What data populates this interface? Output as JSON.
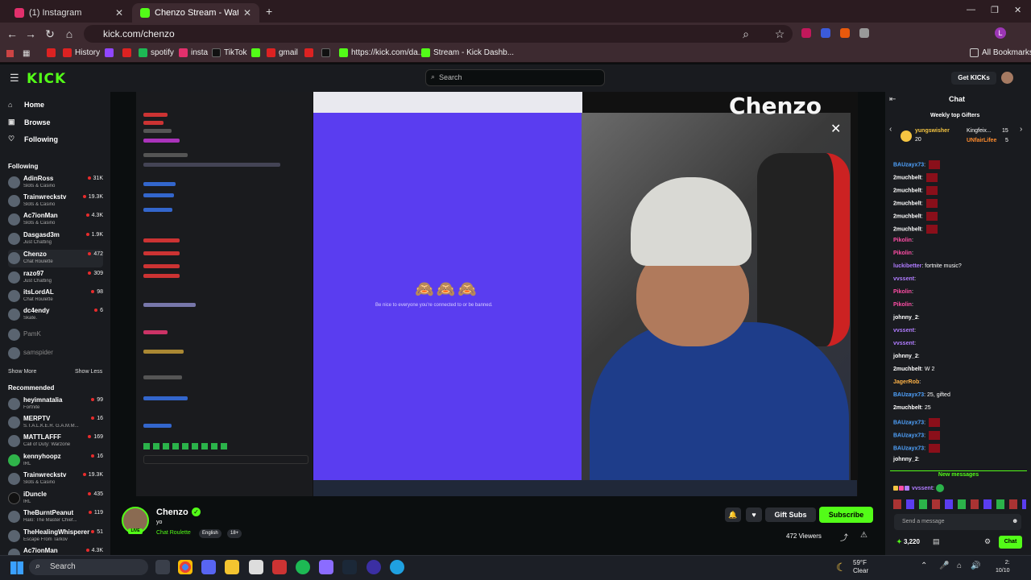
{
  "browser": {
    "tabs": [
      {
        "title": "(1) Instagram",
        "color": "#e1306c"
      },
      {
        "title": "Chenzo Stream - Watch Live on",
        "color": "#53fc18"
      }
    ],
    "url": "kick.com/chenzo",
    "bookmarks": [
      {
        "label": "History",
        "color": "#d22"
      },
      {
        "label": "spotify",
        "color": "#1db954"
      },
      {
        "label": "insta",
        "color": "#e1306c"
      },
      {
        "label": "TikTok",
        "color": "#222"
      },
      {
        "label": "gmail",
        "color": "#d22"
      },
      {
        "label": "https://kick.com/da...",
        "color": "#53fc18"
      },
      {
        "label": "Stream - Kick Dashb...",
        "color": "#53fc18"
      }
    ],
    "all_bookmarks": "All Bookmarks"
  },
  "kick": {
    "logo": "KICK",
    "search_placeholder": "Search",
    "get_kicks": "Get KICKs"
  },
  "sidebar": {
    "nav": [
      {
        "label": "Home",
        "icon": "home-icon"
      },
      {
        "label": "Browse",
        "icon": "browse-icon"
      },
      {
        "label": "Following",
        "icon": "heart-icon"
      }
    ],
    "following_header": "Following",
    "following": [
      {
        "name": "AdinRoss",
        "category": "Slots & Casino",
        "viewers": "31K"
      },
      {
        "name": "Trainwreckstv",
        "category": "Slots & Casino",
        "viewers": "19.3K"
      },
      {
        "name": "Ac7ionMan",
        "category": "Slots & Casino",
        "viewers": "4.3K"
      },
      {
        "name": "Dasgasd3m",
        "category": "Just Chatting",
        "viewers": "1.9K"
      },
      {
        "name": "Chenzo",
        "category": "Chat Roulette",
        "viewers": "472"
      },
      {
        "name": "razo97",
        "category": "Just Chatting",
        "viewers": "309"
      },
      {
        "name": "itsLordAL",
        "category": "Chat Roulette",
        "viewers": "98"
      },
      {
        "name": "dc4endy",
        "category": "Skate.",
        "viewers": "6"
      },
      {
        "name": "PamK",
        "category": "",
        "viewers": ""
      },
      {
        "name": "samspider",
        "category": "",
        "viewers": ""
      }
    ],
    "show_more": "Show More",
    "show_less": "Show Less",
    "recommended_header": "Recommended",
    "recommended": [
      {
        "name": "heyimnatalia",
        "category": "Fortnite",
        "viewers": "99"
      },
      {
        "name": "MERPTV",
        "category": "S.T.A.L.K.E.R. G.A.M.M...",
        "viewers": "16"
      },
      {
        "name": "MATTLAFFF",
        "category": "Call of Duty: Warzone",
        "viewers": "169"
      },
      {
        "name": "kennyhoopz",
        "category": "IRL",
        "viewers": "16"
      },
      {
        "name": "Trainwreckstv",
        "category": "Slots & Casino",
        "viewers": "19.3K"
      },
      {
        "name": "iDuncle",
        "category": "IRL",
        "viewers": "435"
      },
      {
        "name": "TheBurntPeanut",
        "category": "Halo: The Master Chief...",
        "viewers": "119"
      },
      {
        "name": "TheHealingWhisperer",
        "category": "Escape From Tarkov",
        "viewers": "51"
      },
      {
        "name": "Ac7ionMan",
        "category": "",
        "viewers": "4.3K"
      }
    ]
  },
  "stream": {
    "overlay_name": "Chenzo",
    "emojis": "🙈🙈🙈",
    "warning": "Be nice to everyone you're connected to or be banned.",
    "channel": "Chenzo",
    "live": "LIVE",
    "title": "yo",
    "category": "Chat Roulette",
    "tags": [
      "English",
      "18+"
    ],
    "gift_subs": "Gift Subs",
    "subscribe": "Subscribe",
    "viewers": "472 Viewers"
  },
  "chat": {
    "title": "Chat",
    "weekly_header": "Weekly top Gifters",
    "gifters": [
      {
        "name": "yungswisher",
        "count": "20"
      },
      {
        "name": "Kingfeix...",
        "count": "15"
      },
      {
        "name": "UNfairLifee",
        "count": "5"
      }
    ],
    "messages": [
      {
        "user": "BAUzayx73",
        "text": "",
        "color": "#4fa3ff",
        "block": true
      },
      {
        "user": "2muchbelt",
        "text": "",
        "color": "#ffffff",
        "block": true
      },
      {
        "user": "2muchbelt",
        "text": "",
        "color": "#ffffff",
        "block": true
      },
      {
        "user": "2muchbelt",
        "text": "",
        "color": "#ffffff",
        "block": true
      },
      {
        "user": "2muchbelt",
        "text": "",
        "color": "#ffffff",
        "block": true
      },
      {
        "user": "2muchbelt",
        "text": "",
        "color": "#ffffff",
        "block": true
      },
      {
        "user": "Pikolin",
        "text": "",
        "color": "#ff4da6",
        "block": false
      },
      {
        "user": "Pikolin",
        "text": "",
        "color": "#ff4da6",
        "block": false
      },
      {
        "user": "luckibetter",
        "text": "fortnite music?",
        "color": "#b07cff",
        "block": false
      },
      {
        "user": "vvssent",
        "text": "",
        "color": "#b07cff",
        "block": false
      },
      {
        "user": "Pikolin",
        "text": "",
        "color": "#ff4da6",
        "block": false
      },
      {
        "user": "Pikolin",
        "text": "",
        "color": "#ff4da6",
        "block": false
      },
      {
        "user": "johnny_2",
        "text": "",
        "color": "#ffffff",
        "block": false
      },
      {
        "user": "vvssent",
        "text": "",
        "color": "#b07cff",
        "block": false
      },
      {
        "user": "vvssent",
        "text": "",
        "color": "#b07cff",
        "block": false
      },
      {
        "user": "johnny_2",
        "text": "",
        "color": "#ffffff",
        "block": false
      },
      {
        "user": "2muchbelt",
        "text": "W 2",
        "color": "#ffffff",
        "block": false
      },
      {
        "user": "JagerRob",
        "text": "",
        "color": "#ffb347",
        "block": false
      },
      {
        "user": "BAUzayx73",
        "text": "25, gifted",
        "color": "#4fa3ff",
        "block": false
      },
      {
        "user": "2muchbelt",
        "text": "25",
        "color": "#ffffff",
        "block": false
      },
      {
        "user": "BAUzayx73",
        "text": "",
        "color": "#4fa3ff",
        "block": true
      },
      {
        "user": "BAUzayx73",
        "text": "",
        "color": "#4fa3ff",
        "block": true
      },
      {
        "user": "BAUzayx73",
        "text": "",
        "color": "#4fa3ff",
        "block": true
      },
      {
        "user": "johnny_2",
        "text": "",
        "color": "#ffffff",
        "block": false
      }
    ],
    "new_messages": "New messages",
    "last_message_user": "vvssent",
    "input_placeholder": "Send a message",
    "points": "3,220",
    "chat_button": "Chat"
  },
  "taskbar": {
    "search": "Search",
    "weather_temp": "59°F",
    "weather_cond": "Clear",
    "time": "2:",
    "date": "10/10"
  }
}
